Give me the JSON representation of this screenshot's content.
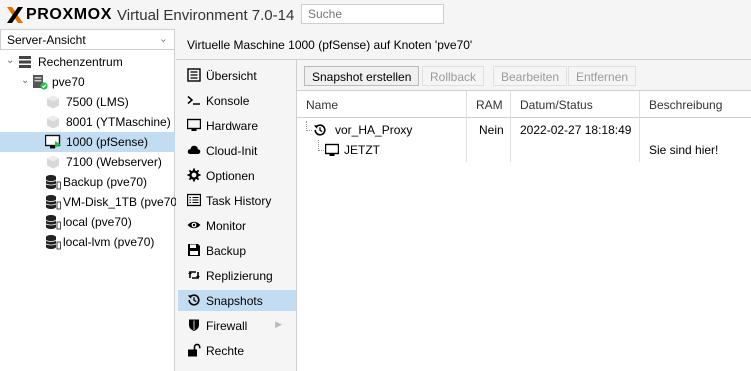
{
  "header": {
    "logo_text": "PROXMOX",
    "product": "Virtual Environment 7.0-14",
    "search_placeholder": "Suche"
  },
  "left": {
    "view_select": "Server-Ansicht",
    "tree": [
      {
        "label": "Rechenzentrum",
        "icon": "datacenter-icon"
      },
      {
        "label": "pve70",
        "icon": "node-online-icon"
      },
      {
        "label": "7500 (LMS)",
        "icon": "vm-stopped-icon"
      },
      {
        "label": "8001 (YTMaschine)",
        "icon": "vm-stopped-icon"
      },
      {
        "label": "1000 (pfSense)",
        "icon": "vm-running-icon"
      },
      {
        "label": "7100 (Webserver)",
        "icon": "vm-stopped-icon"
      },
      {
        "label": "Backup (pve70)",
        "icon": "storage-icon"
      },
      {
        "label": "VM-Disk_1TB (pve70",
        "icon": "storage-icon"
      },
      {
        "label": "local (pve70)",
        "icon": "storage-icon"
      },
      {
        "label": "local-lvm (pve70)",
        "icon": "storage-icon"
      }
    ]
  },
  "content": {
    "title": "Virtuelle Maschine 1000 (pfSense) auf Knoten 'pve70'"
  },
  "nav": {
    "items": [
      {
        "label": "Übersicht",
        "icon": "summary-icon"
      },
      {
        "label": "Konsole",
        "icon": "terminal-icon"
      },
      {
        "label": "Hardware",
        "icon": "monitor-icon"
      },
      {
        "label": "Cloud-Init",
        "icon": "cloud-icon"
      },
      {
        "label": "Optionen",
        "icon": "gear-icon"
      },
      {
        "label": "Task History",
        "icon": "list-icon"
      },
      {
        "label": "Monitor",
        "icon": "eye-icon"
      },
      {
        "label": "Backup",
        "icon": "floppy-icon"
      },
      {
        "label": "Replizierung",
        "icon": "retweet-icon"
      },
      {
        "label": "Snapshots",
        "icon": "history-icon"
      },
      {
        "label": "Firewall",
        "icon": "shield-icon"
      },
      {
        "label": "Rechte",
        "icon": "unlock-icon"
      }
    ],
    "selected_index": 9
  },
  "toolbar": {
    "take_snapshot": "Snapshot erstellen",
    "rollback": "Rollback",
    "edit": "Bearbeiten",
    "remove": "Entfernen"
  },
  "grid": {
    "columns": [
      "Name",
      "RAM",
      "Datum/Status",
      "Beschreibung"
    ],
    "rows": [
      {
        "name": "vor_HA_Proxy",
        "ram": "Nein",
        "date": "2022-02-27 18:18:49",
        "description": "",
        "icon": "history-icon"
      },
      {
        "name": "JETZT",
        "ram": "",
        "date": "",
        "description": "Sie sind hier!",
        "icon": "monitor-icon"
      }
    ]
  },
  "colors": {
    "selection": "#c2ddf2",
    "running": "#21bf4b",
    "accent_orange": "#e57000"
  }
}
